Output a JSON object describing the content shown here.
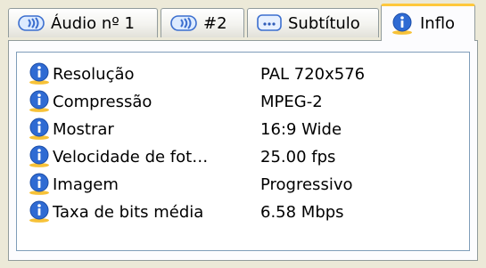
{
  "tabs": [
    {
      "label": "Áudio nº 1",
      "icon": "audio-speaker-icon"
    },
    {
      "label": "#2",
      "icon": "audio-speaker-icon"
    },
    {
      "label": "Subtítulo",
      "icon": "subtitle-icon"
    },
    {
      "label": "Inflo",
      "icon": "info-icon",
      "active": true
    }
  ],
  "info": {
    "rows": [
      {
        "label": "Resolução",
        "value": "PAL 720x576"
      },
      {
        "label": "Compressão",
        "value": "MPEG-2"
      },
      {
        "label": "Mostrar",
        "value": "16:9 Wide"
      },
      {
        "label": "Velocidade de fot…",
        "value": "25.00 fps"
      },
      {
        "label": "Imagem",
        "value": "Progressivo"
      },
      {
        "label": "Taxa de bits média",
        "value": "6.58 Mbps"
      }
    ]
  },
  "colors": {
    "window_bg": "#ECE9D8",
    "active_tab_accent": "#FFC83C",
    "info_icon_blue": "#2F6BD3",
    "info_icon_yellow": "#F7C238"
  }
}
